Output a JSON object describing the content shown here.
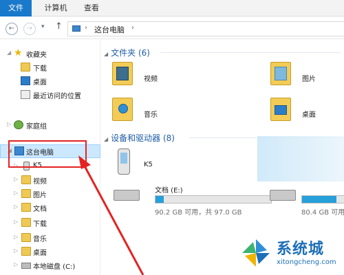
{
  "ribbon": {
    "tabs": [
      {
        "label": "文件",
        "active": true
      },
      {
        "label": "计算机",
        "active": false
      },
      {
        "label": "查看",
        "active": false
      }
    ]
  },
  "address": {
    "back_icon": "←",
    "forward_icon": "→",
    "history_icon": "▾",
    "up_icon": "↑",
    "separator": "›",
    "location": "这台电脑",
    "location_icon": "computer-icon"
  },
  "nav": {
    "favorites": {
      "label": "收藏夹",
      "icon": "star-icon"
    },
    "downloads": {
      "label": "下载",
      "icon": "downloads-folder-icon"
    },
    "desktop": {
      "label": "桌面",
      "icon": "desktop-icon"
    },
    "recent": {
      "label": "最近访问的位置",
      "icon": "recent-places-icon"
    },
    "homegroup": {
      "label": "家庭组",
      "icon": "homegroup-icon"
    },
    "thispc": {
      "label": "这台电脑",
      "icon": "computer-icon",
      "selected": true
    },
    "children": [
      {
        "label": "K5",
        "icon": "phone-icon"
      },
      {
        "label": "视频",
        "icon": "videos-folder-icon"
      },
      {
        "label": "图片",
        "icon": "pictures-folder-icon"
      },
      {
        "label": "文档",
        "icon": "documents-folder-icon"
      },
      {
        "label": "下载",
        "icon": "downloads-folder-icon"
      },
      {
        "label": "音乐",
        "icon": "music-folder-icon"
      },
      {
        "label": "桌面",
        "icon": "desktop-folder-icon"
      },
      {
        "label": "本地磁盘 (C:)",
        "icon": "drive-icon"
      }
    ]
  },
  "content": {
    "folders_group": "文件夹 (6)",
    "folders": [
      {
        "label": "视频",
        "icon": "videos-folder-icon"
      },
      {
        "label": "图片",
        "icon": "pictures-folder-icon"
      },
      {
        "label": "音乐",
        "icon": "music-folder-icon"
      },
      {
        "label": "桌面",
        "icon": "desktop-folder-icon"
      }
    ],
    "devices_group": "设备和驱动器 (8)",
    "device_k5": {
      "label": "K5",
      "icon": "phone-icon"
    },
    "drives": [
      {
        "name": "文档 (E:)",
        "info": "90.2 GB 可用，共 97.0 GB",
        "used_fraction": 0.07
      },
      {
        "name": "",
        "info": "80.4 GB 可用",
        "used_fraction": 0.3
      }
    ]
  },
  "watermark": {
    "cn": "系统城",
    "en": "xitongcheng.com"
  },
  "colors": {
    "accent": "#1979ca",
    "selection": "#cce8ff",
    "annotation": "#e42222",
    "group_header": "#1e5da6"
  }
}
